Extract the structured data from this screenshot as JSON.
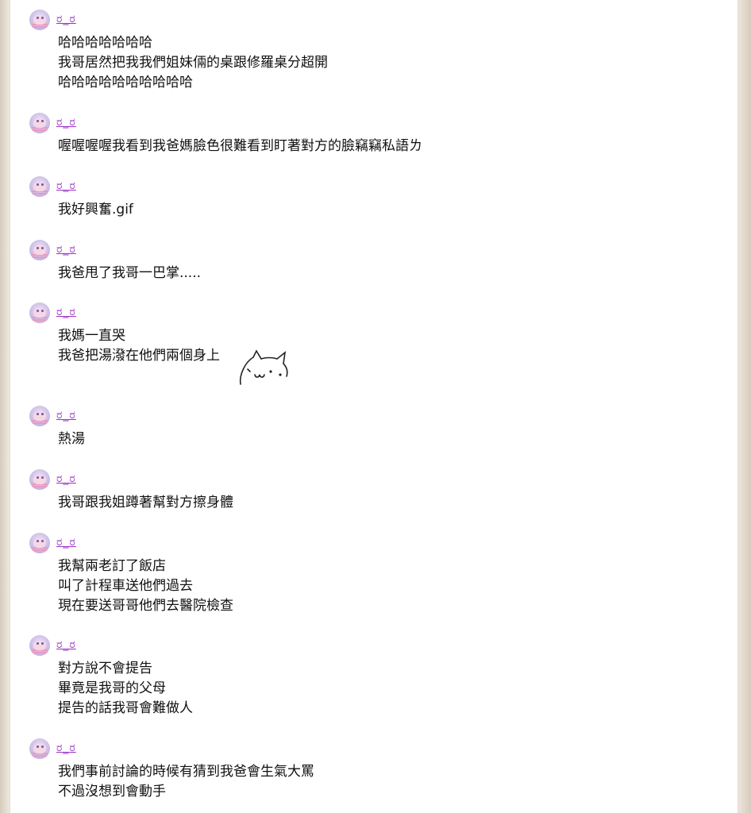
{
  "posts": [
    {
      "user": "ರ_ರ",
      "lines": [
        "哈哈哈哈哈哈哈",
        "我哥居然把我我們姐妹倆的桌跟修羅桌分超開",
        "哈哈哈哈哈哈哈哈哈哈"
      ]
    },
    {
      "user": "ರ_ರ",
      "lines": [
        "喔喔喔喔我看到我爸媽臉色很難看到盯著對方的臉竊竊私語ㄌ"
      ]
    },
    {
      "user": "ರ_ರ",
      "lines": [
        "我好興奮.gif"
      ]
    },
    {
      "user": "ರ_ರ",
      "lines": [
        "我爸甩了我哥一巴掌....."
      ]
    },
    {
      "user": "ರ_ರ",
      "lines": [
        "我媽一直哭",
        "我爸把湯潑在他們兩個身上"
      ]
    },
    {
      "user": "ರ_ರ",
      "lines": [
        "熱湯"
      ]
    },
    {
      "user": "ರ_ರ",
      "lines": [
        "我哥跟我姐蹲著幫對方擦身體"
      ]
    },
    {
      "user": "ರ_ರ",
      "lines": [
        "我幫兩老訂了飯店",
        "叫了計程車送他們過去",
        "現在要送哥哥他們去醫院檢查"
      ]
    },
    {
      "user": "ರ_ರ",
      "lines": [
        "對方說不會提告",
        "畢竟是我哥的父母",
        "提告的話我哥會難做人"
      ]
    },
    {
      "user": "ರ_ರ",
      "lines": [
        "我們事前討論的時候有猜到我爸會生氣大罵",
        "不過沒想到會動手"
      ]
    }
  ],
  "sticker": {
    "icon": "cat-sticker-icon"
  }
}
